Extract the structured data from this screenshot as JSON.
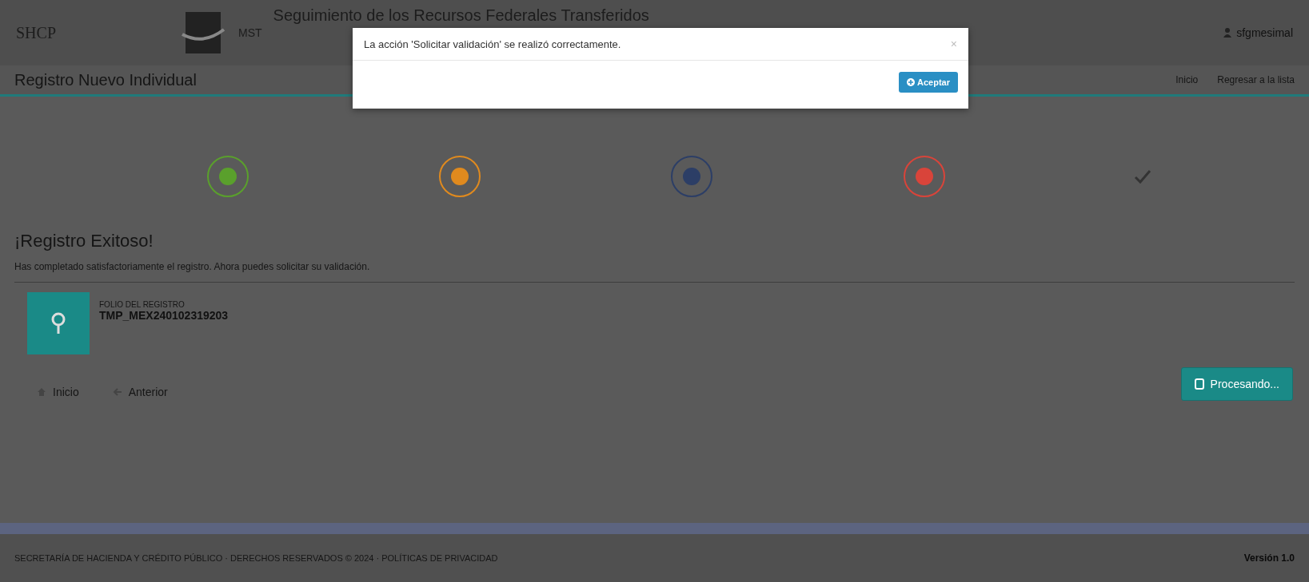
{
  "header": {
    "logo": "SHCP",
    "app_short": "MST",
    "title": "Seguimiento de los Recursos Federales Transferidos",
    "user": "sfgmesimal"
  },
  "title_bar": {
    "title": "Registro Nuevo Individual",
    "links": [
      "Inicio",
      "Regresar a la lista"
    ]
  },
  "steps": [
    {
      "kind": "circle",
      "color": "#5aa02c"
    },
    {
      "kind": "circle",
      "color": "#e08a1e"
    },
    {
      "kind": "circle",
      "color": "#2c3e66"
    },
    {
      "kind": "circle",
      "color": "#d9443a"
    },
    {
      "kind": "check",
      "color": "#333333"
    }
  ],
  "result": {
    "heading": "¡Registro Exitoso!",
    "message": "Has completado satisfactoriamente el registro. Ahora puedes solicitar su validación.",
    "folio_label": "FOLIO DEL REGISTRO",
    "folio": "TMP_MEX240102319203"
  },
  "nav_buttons": [
    "Inicio",
    "Anterior"
  ],
  "process_button": "Procesando...",
  "footer": {
    "text": "SECRETARÍA DE HACIENDA Y CRÉDITO PÚBLICO · DERECHOS RESERVADOS © 2024 · POLÍTICAS DE PRIVACIDAD",
    "version": "Versión 1.0"
  },
  "modal": {
    "message": "La acción 'Solicitar validación' se realizó correctamente.",
    "close": "×",
    "button": "Aceptar"
  }
}
